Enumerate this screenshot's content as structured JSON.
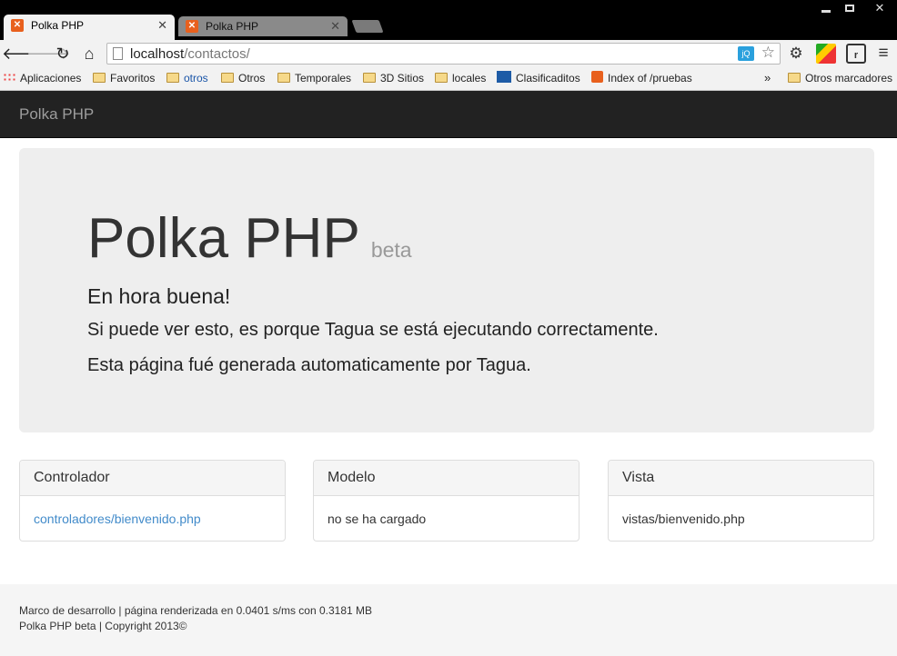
{
  "browser": {
    "tabs": [
      {
        "title": "Polka PHP",
        "active": true
      },
      {
        "title": "Polka PHP",
        "active": false
      }
    ],
    "url_host": "localhost",
    "url_path": "/contactos/",
    "bookmarks": [
      {
        "label": "Aplicaciones",
        "icon": "apps-icon"
      },
      {
        "label": "Favoritos",
        "icon": "folder-icon"
      },
      {
        "label": "otros",
        "icon": "folder-icon"
      },
      {
        "label": "Otros",
        "icon": "folder-icon"
      },
      {
        "label": "Temporales",
        "icon": "folder-icon"
      },
      {
        "label": "3D Sitios",
        "icon": "folder-icon"
      },
      {
        "label": "locales",
        "icon": "folder-icon"
      },
      {
        "label": "Clasificaditos",
        "icon": "cd-icon"
      },
      {
        "label": "Index of /pruebas",
        "icon": "xampp-icon"
      }
    ],
    "bookmarks_more": "»",
    "other_bookmarks": "Otros marcadores",
    "jq_badge": "jQ"
  },
  "navbar": {
    "brand": "Polka PHP"
  },
  "jumbotron": {
    "title": "Polka PHP",
    "badge": "beta",
    "subtitle": "En hora buena!",
    "line1": "Si puede ver esto, es porque Tagua se está ejecutando correctamente.",
    "line2": "Esta página fué generada automaticamente por Tagua."
  },
  "panels": [
    {
      "heading": "Controlador",
      "body": "controladores/bienvenido.php"
    },
    {
      "heading": "Modelo",
      "body": "no se ha cargado"
    },
    {
      "heading": "Vista",
      "body": "vistas/bienvenido.php"
    }
  ],
  "footer": {
    "line1": "Marco de desarrollo | página renderizada en 0.0401 s/ms con 0.3181 MB",
    "line2": "Polka PHP beta | Copyright 2013©"
  }
}
